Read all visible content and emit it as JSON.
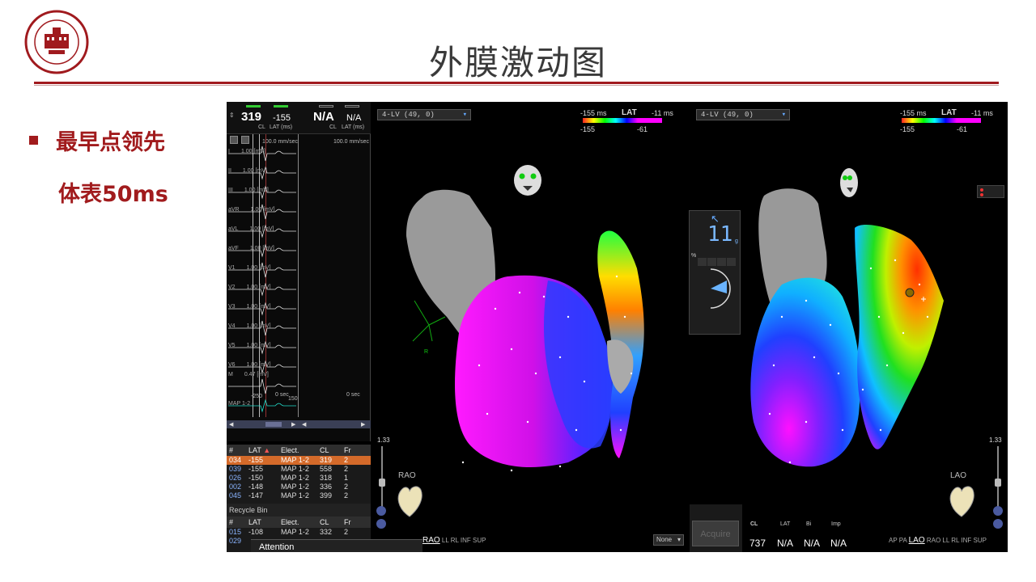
{
  "slide": {
    "title": "外膜激动图",
    "bullet_line1": "最早点领先",
    "bullet_line2": "体表50ms",
    "logo_text": "THE FIRST AFFILIATED HOSPITAL OF XINXIANG MEDICAL UNIVERSITY",
    "accent_color": "#a01a1e"
  },
  "ecg": {
    "cl_value": "319",
    "lat_value": "-155",
    "cl_label": "CL",
    "lat_label": "LAT (ms)",
    "na_value": "N/A",
    "na_value2": "N/A",
    "speed_left": "100.0 mm/sec",
    "speed_right": "100.0 mm/sec",
    "leads": [
      "I",
      "II",
      "III",
      "aVR",
      "aVL",
      "aVF",
      "V1",
      "V2",
      "V3",
      "V4",
      "V5",
      "V6",
      "M",
      "MAP 1-2"
    ],
    "gain": "1.00",
    "unit": "[mV]",
    "gain_last": "0.47",
    "map_range_low": "-250",
    "map_range_high": "150",
    "zero_sec": "0 sec",
    "zero_sec2": "0 sec"
  },
  "table": {
    "headers": [
      "#",
      "LAT",
      "Elect.",
      "CL",
      "Fr"
    ],
    "rows": [
      [
        "034",
        "-155",
        "MAP 1-2",
        "319",
        "2"
      ],
      [
        "039",
        "-155",
        "MAP 1-2",
        "558",
        "2"
      ],
      [
        "026",
        "-150",
        "MAP 1-2",
        "318",
        "1"
      ],
      [
        "002",
        "-148",
        "MAP 1-2",
        "336",
        "2"
      ],
      [
        "045",
        "-147",
        "MAP 1-2",
        "399",
        "2"
      ]
    ],
    "recycle_label": "Recycle Bin",
    "recycle_headers": [
      "#",
      "LAT",
      "Elect.",
      "CL",
      "Fr"
    ],
    "recycle_rows": [
      [
        "015",
        "-108",
        "MAP 1-2",
        "332",
        "2"
      ],
      [
        "029",
        "",
        "",
        "",
        ""
      ]
    ],
    "attention": "Attention"
  },
  "maps": {
    "left": {
      "selector": "4-LV (49, 0)",
      "lat_label": "LAT",
      "range_min": "-155 ms",
      "range_max": "-11 ms",
      "cur_min": "-155",
      "cur_max": "-61",
      "zoom": "1.33",
      "view": "RAO",
      "tabs_active": "RAO",
      "tabs": [
        "LL",
        "RL",
        "INF",
        "SUP"
      ],
      "axis_letter": "R"
    },
    "right": {
      "selector": "4-LV (49, 0)",
      "lat_label": "LAT",
      "range_min": "-155 ms",
      "range_max": "-11 ms",
      "cur_min": "-155",
      "cur_max": "-61",
      "zoom": "1.33",
      "view": "LAO",
      "tabs_before": [
        "AP",
        "PA"
      ],
      "tabs_active": "LAO",
      "tabs": [
        "RAO",
        "LL",
        "RL",
        "INF",
        "SUP"
      ]
    }
  },
  "force": {
    "value": "11",
    "unit": "g",
    "pct": "%"
  },
  "acquire": {
    "none_label": "None",
    "button": "Acquire",
    "cl_label": "CL",
    "lat_label": "LAT",
    "bi_label": "Bi",
    "imp_label": "Imp",
    "cl_value": "737",
    "lat_value": "N/A",
    "bi_value": "N/A",
    "imp_value": "N/A"
  }
}
